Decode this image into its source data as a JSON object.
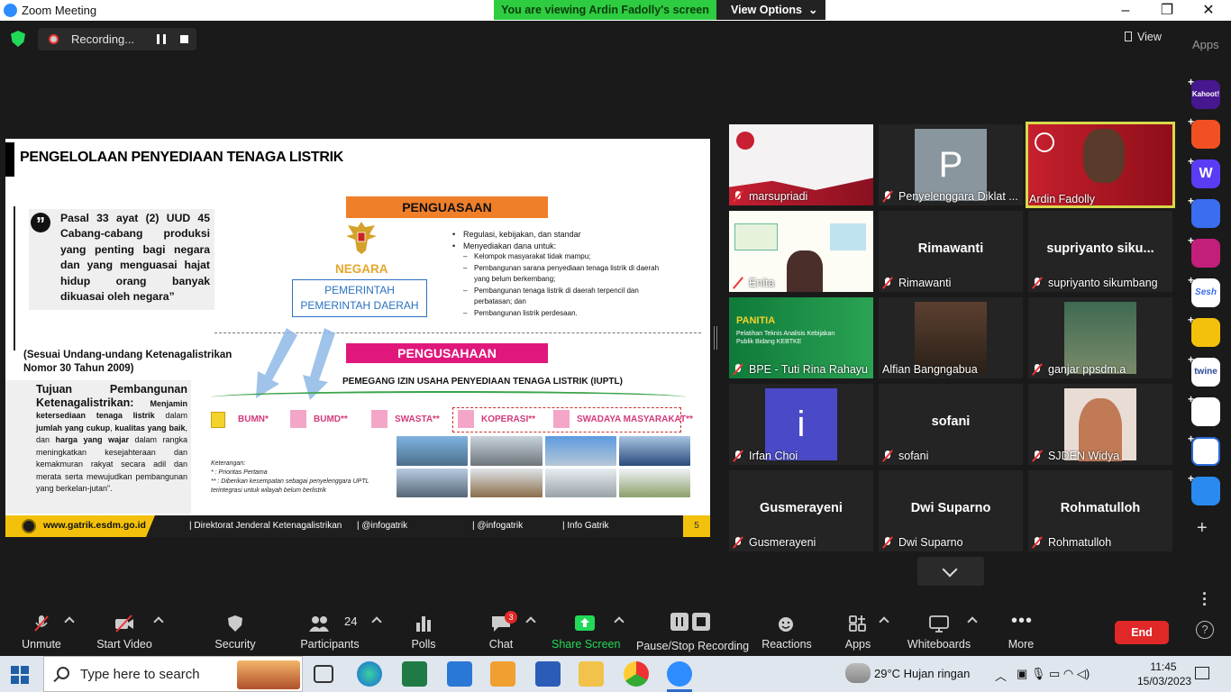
{
  "window": {
    "title": "Zoom Meeting",
    "controls": [
      "–",
      "❐",
      "✕"
    ]
  },
  "banner": {
    "viewing": "You are viewing Ardin Fadolly's screen",
    "view_options": "View Options"
  },
  "top": {
    "recording_label": "Recording...",
    "view_label": "View",
    "apps_label": "Apps"
  },
  "slide": {
    "title": "PENGELOLAAN PENYEDIAAN TENAGA LISTRIK",
    "quote": "Pasal 33 ayat (2) UUD 45 Cabang-cabang produksi yang penting bagi negara dan yang menguasai hajat hidup orang banyak dikuasai oleh negara”",
    "sesuai": "(Sesuai Undang-undang Ketenagalistrikan Nomor 30 Tahun 2009)",
    "tujuan_head": "Tujuan Pembangunan Ketenagalistrikan:",
    "tujuan_p1": "Menjamin ketersediaan tenaga listrik",
    "tujuan_p2": "dalam",
    "tujuan_p3": "jumlah yang cukup",
    "tujuan_p4": ",",
    "tujuan_p5": "kualitas yang baik",
    "tujuan_p6": ", dan",
    "tujuan_p7": "harga yang wajar",
    "tujuan_p8": "dalam rangka meningkatkan kesejahteraan dan kemakmuran rakyat secara adil dan merata serta mewujudkan pembangunan yang berkelan-jutan”.",
    "penguasaan": "PENGUASAAN",
    "negara": "NEGARA",
    "pemerintah1": "PEMERINTAH",
    "pemerintah2": "PEMERINTAH DAERAH",
    "bullet1": "Regulasi, kebijakan, dan standar",
    "bullet2": "Menyediakan dana untuk:",
    "sub1": "Kelompok masyarakat tidak mampu;",
    "sub2": "Pembangunan sarana penyediaan tenaga listrik di daerah yang belum berkembang;",
    "sub3": "Pembangunan tenaga listrik di daerah terpencil dan perbatasan; dan",
    "sub4": "Pembangunan listrik perdesaan.",
    "pengusahaan": "PENGUSAHAAN",
    "pemegang": "PEMEGANG IZIN USAHA PENYEDIAAN TENAGA LISTRIK (IUPTL)",
    "ent_bumn": "BUMN*",
    "ent_bumd": "BUMD**",
    "ent_swasta": "SWASTA**",
    "ent_koperasi": "KOPERASI**",
    "ent_swadaya": "SWADAYA MASYARAKAT**",
    "ket_title": "Keterangan:",
    "ket1": "*   : Prioritas Pertama",
    "ket2": "**  : Diberikan kesempatan sebagai penyelenggara UPTL terintegrasi untuk wilayah belum berlistrik",
    "footer_web": "www.gatrik.esdm.go.id",
    "footer_fb": "| Direktorat Jenderal Ketenagalistrikan",
    "footer_tw": "| @infogatrik",
    "footer_ig": "| @infogatrik",
    "footer_yt": "| Info Gatrik",
    "page": "5"
  },
  "participants": [
    {
      "name": "marsupriadi",
      "big": ""
    },
    {
      "name": "Penyelenggara Diklat ...",
      "big": "",
      "avatar": "P"
    },
    {
      "name": "Ardin Fadolly",
      "big": ""
    },
    {
      "name": "Enita",
      "big": ""
    },
    {
      "name": "Rimawanti",
      "big": "Rimawanti"
    },
    {
      "name": "supriyanto sikumbang",
      "big": "supriyanto  siku..."
    },
    {
      "name": "BPE - Tuti Rina Rahayu",
      "big": ""
    },
    {
      "name": "Alfian Bangngabua",
      "big": ""
    },
    {
      "name": "ganjar ppsdm.a",
      "big": ""
    },
    {
      "name": "Irfan Choi",
      "big": "",
      "avatar": "i"
    },
    {
      "name": "sofani",
      "big": "sofani"
    },
    {
      "name": "SJDEN Widya",
      "big": ""
    },
    {
      "name": "Gusmerayeni",
      "big": "Gusmerayeni"
    },
    {
      "name": "Dwi Suparno",
      "big": "Dwi Suparno"
    },
    {
      "name": "Rohmatulloh",
      "big": "Rohmatulloh"
    }
  ],
  "tile_extra": {
    "panitia": "PANITIA",
    "panitia_sub": "Pelatihan Teknis Analisis Kebijakan Publik Bidang KEBTKE"
  },
  "rail_apps": [
    "Kahoot!",
    "",
    "W",
    "",
    "",
    "Sesh",
    "",
    "twine",
    "",
    "",
    ""
  ],
  "toolbar": {
    "unmute": "Unmute",
    "start_video": "Start Video",
    "security": "Security",
    "participants": "Participants",
    "participants_count": "24",
    "polls": "Polls",
    "chat": "Chat",
    "chat_badge": "3",
    "share": "Share Screen",
    "pause_stop": "Pause/Stop Recording",
    "reactions": "Reactions",
    "apps": "Apps",
    "whiteboards": "Whiteboards",
    "more": "More",
    "end": "End"
  },
  "taskbar": {
    "search_placeholder": "Type here to search",
    "weather": "29°C  Hujan ringan",
    "time": "11:45",
    "date": "15/03/2023"
  },
  "colors": {
    "share_green": "#23d959",
    "end_red": "#e02828",
    "zoom_blue": "#2d8cff"
  }
}
